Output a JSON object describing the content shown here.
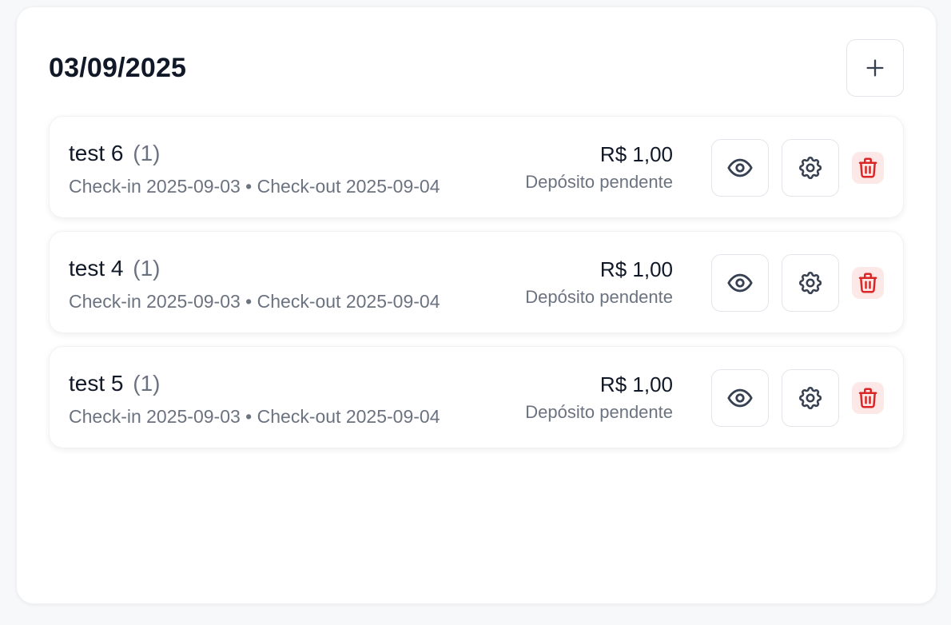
{
  "header": {
    "title": "03/09/2025",
    "add_icon": "plus-icon"
  },
  "reservations": [
    {
      "name": "test 6",
      "count": "(1)",
      "dates": "Check-in 2025-09-03 • Check-out 2025-09-04",
      "price": "R$ 1,00",
      "status": "Depósito pendente"
    },
    {
      "name": "test 4",
      "count": "(1)",
      "dates": "Check-in 2025-09-03 • Check-out 2025-09-04",
      "price": "R$ 1,00",
      "status": "Depósito pendente"
    },
    {
      "name": "test 5",
      "count": "(1)",
      "dates": "Check-in 2025-09-03 • Check-out 2025-09-04",
      "price": "R$ 1,00",
      "status": "Depósito pendente"
    }
  ],
  "row_icons": [
    "eye-icon",
    "gear-icon",
    "trash-icon"
  ],
  "colors": {
    "text": "#111827",
    "muted": "#6b7280",
    "icon": "#374151",
    "danger": "#dc2626",
    "danger_bg": "#fde8e8"
  }
}
